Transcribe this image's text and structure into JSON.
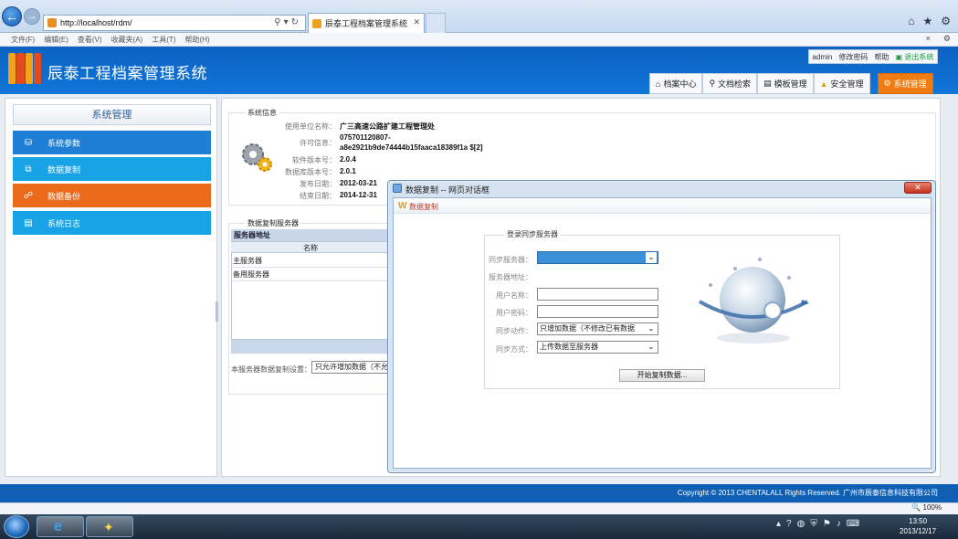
{
  "browser": {
    "url": "http://localhost/rdm/",
    "tab_title": "辰泰工程档案管理系统",
    "menu": [
      "文件(F)",
      "编辑(E)",
      "查看(V)",
      "收藏夹(A)",
      "工具(T)",
      "帮助(H)"
    ],
    "menu_right": [
      "×",
      "⚙"
    ]
  },
  "app": {
    "title": "辰泰工程档案管理系统",
    "user": {
      "name": "admin",
      "change_password": "修改密码",
      "help": "帮助",
      "logout": "退出系统"
    },
    "topnav": [
      {
        "label": "档案中心",
        "icon": "home-icon"
      },
      {
        "label": "文档检索",
        "icon": "search-icon"
      },
      {
        "label": "模板管理",
        "icon": "template-icon"
      },
      {
        "label": "安全管理",
        "icon": "lock-icon"
      },
      {
        "label": "系统管理",
        "icon": "gear-icon",
        "active": true
      }
    ]
  },
  "sidebar": {
    "title": "系统管理",
    "items": [
      {
        "label": "系统参数",
        "color": "#1f7fd6"
      },
      {
        "label": "数据复制",
        "color": "#18a3e6"
      },
      {
        "label": "数据备份",
        "color": "#ec6a1c",
        "active": true
      },
      {
        "label": "系统日志",
        "color": "#18a3e6"
      }
    ]
  },
  "sysinfo": {
    "legend": "系统信息",
    "rows": [
      {
        "key": "使用单位名称：",
        "value": "广三高速公路扩建工程管理处"
      },
      {
        "key": "许可信息：",
        "value": "075701120807-"
      },
      {
        "key": "",
        "value": "a8e2921b9de74444b15faaca18389f1a $[2]"
      },
      {
        "key": "软件版本号：",
        "value": "2.0.4"
      },
      {
        "key": "数据库版本号：",
        "value": "2.0.1"
      },
      {
        "key": "发布日期：",
        "value": "2012-03-21"
      },
      {
        "key": "结束日期：",
        "value": "2014-12-31"
      }
    ]
  },
  "replication": {
    "legend": "数据复制服务器",
    "table_header": "服务器地址",
    "column": "名称",
    "rows": [
      "主服务器",
      "备用服务器"
    ],
    "setting_label": "本服务器数据复制设置：",
    "setting_value": "只允许增加数据（不允"
  },
  "footer": {
    "copyright": "Copyright © 2013 CHENTALALL Rights Reserved. 广州市辰泰信息科技有限公司"
  },
  "statusbar": {
    "zoom": "🔍 100%"
  },
  "dialog": {
    "title": "数据复制 -- 网页对话框",
    "header": "数据复制",
    "legend": "登录同步服务器",
    "fields": [
      {
        "label": "同步服务器：",
        "value": "",
        "type": "select"
      },
      {
        "label": "服务器地址：",
        "value": "",
        "type": "text-static"
      },
      {
        "label": "用户名称：",
        "value": "",
        "type": "input"
      },
      {
        "label": "用户密码：",
        "value": "",
        "type": "input"
      },
      {
        "label": "同步动作：",
        "value": "只增加数据（不修改已有数据",
        "type": "select"
      },
      {
        "label": "同步方式：",
        "value": "上传数据至服务器",
        "type": "select"
      }
    ],
    "start_button": "开始复制数据..."
  },
  "taskbar": {
    "time": "13:50",
    "date": "2013/12/17"
  }
}
